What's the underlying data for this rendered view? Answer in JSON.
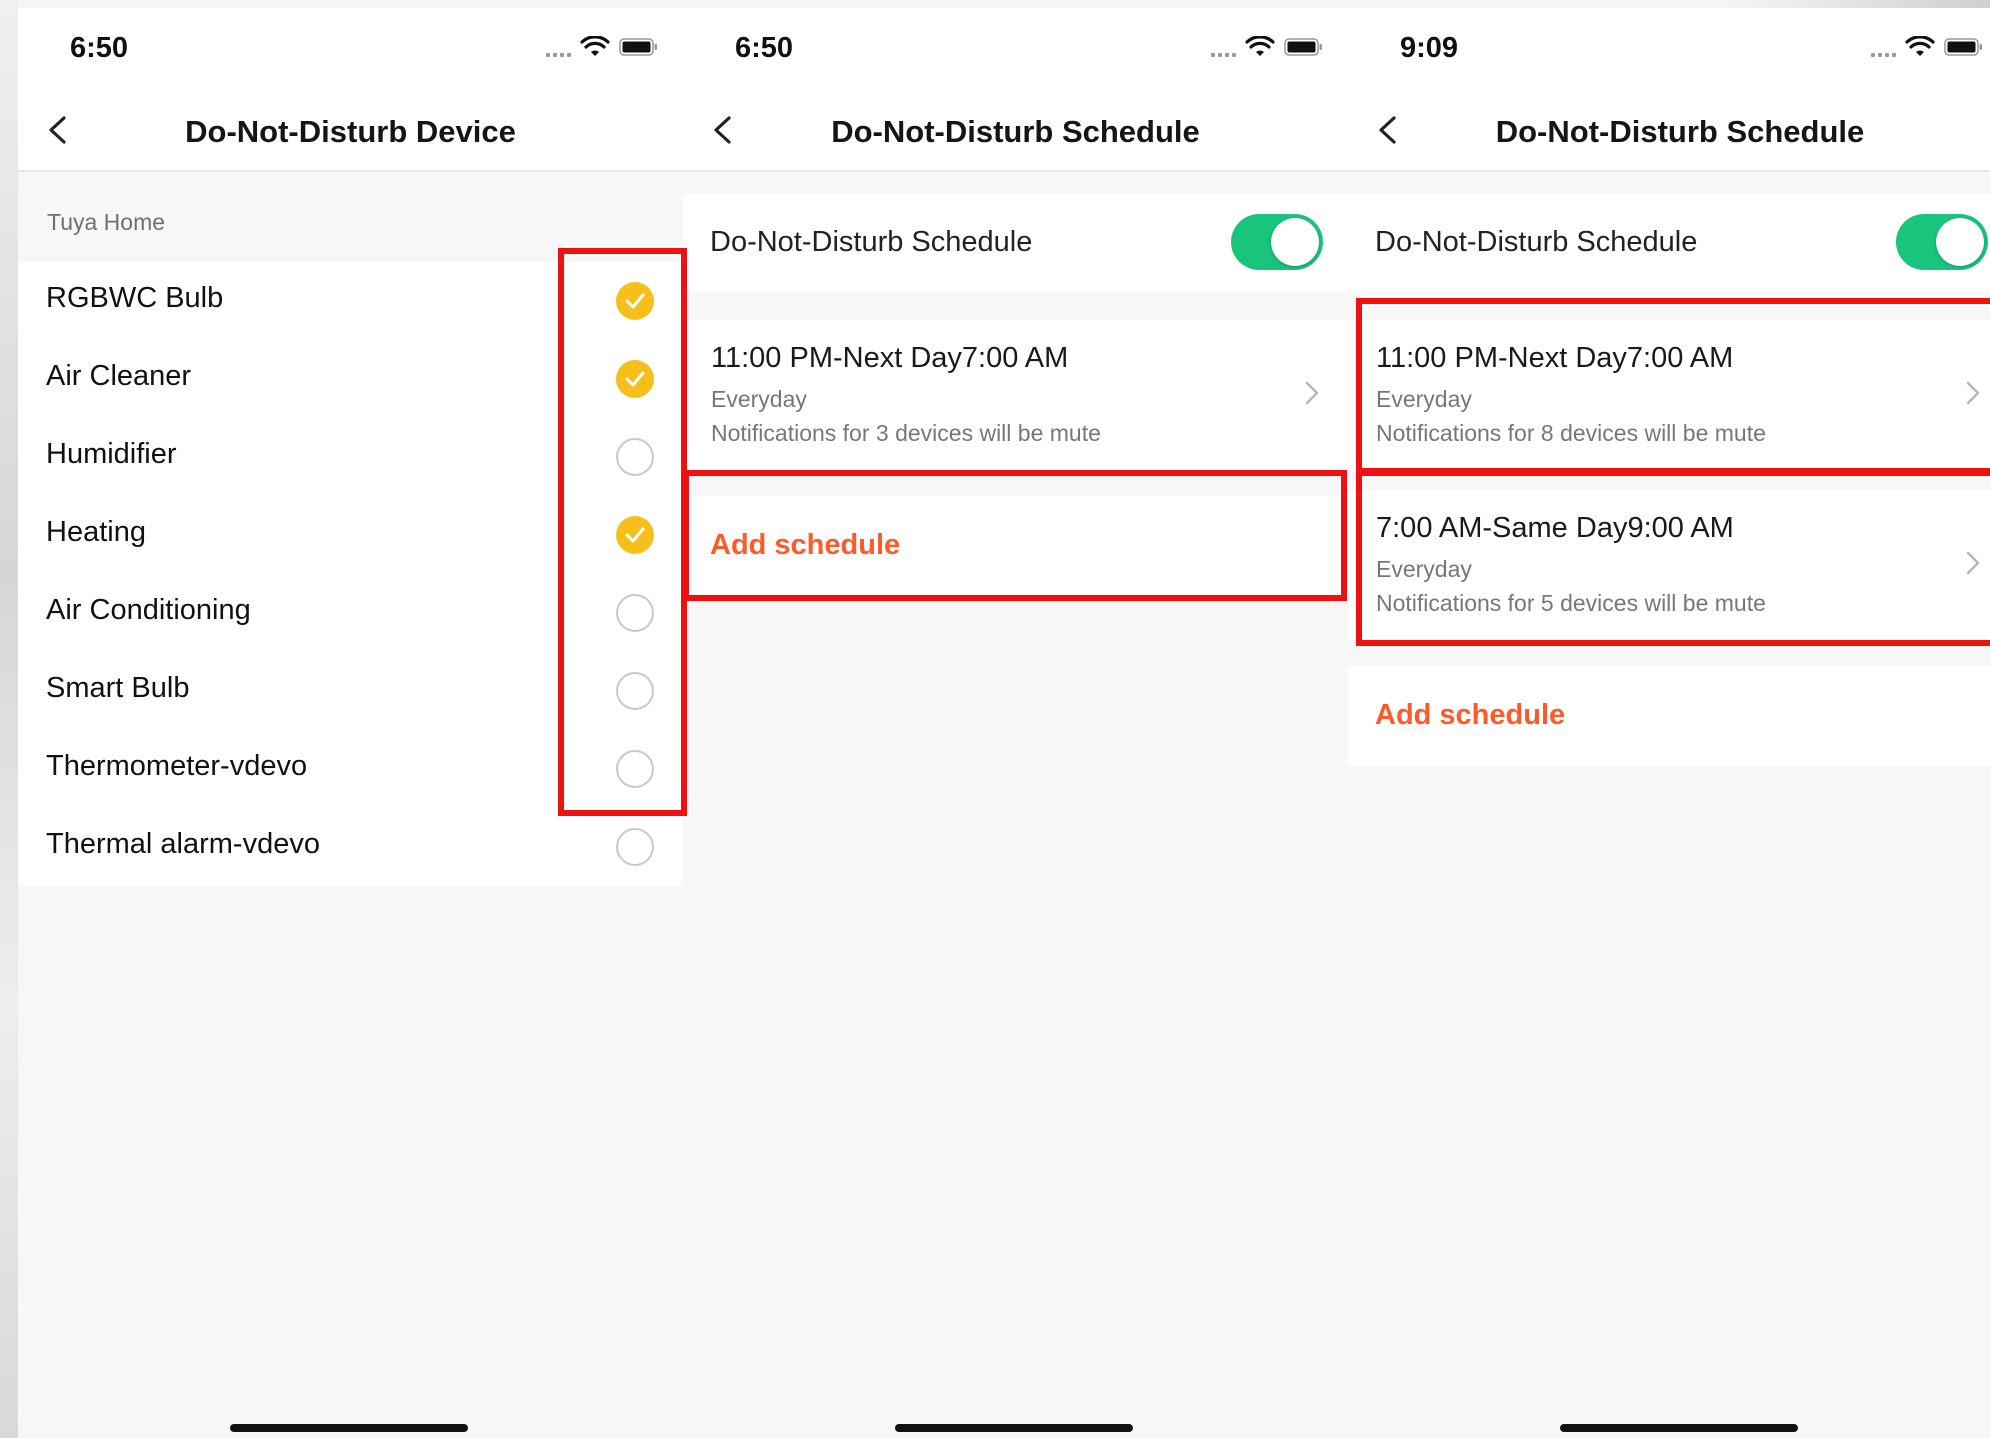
{
  "screens": [
    {
      "status_time": "6:50",
      "title": "Do-Not-Disturb Device",
      "section_label": "Tuya Home",
      "devices": [
        {
          "name": "RGBWC Bulb",
          "checked": true
        },
        {
          "name": "Air Cleaner",
          "checked": true
        },
        {
          "name": "Humidifier",
          "checked": false
        },
        {
          "name": "Heating",
          "checked": true
        },
        {
          "name": "Air Conditioning",
          "checked": false
        },
        {
          "name": "Smart Bulb",
          "checked": false
        },
        {
          "name": "Thermometer-vdevo",
          "checked": false
        },
        {
          "name": "Thermal alarm-vdevo",
          "checked": false
        }
      ]
    },
    {
      "status_time": "6:50",
      "title": "Do-Not-Disturb Schedule",
      "toggle_label": "Do-Not-Disturb Schedule",
      "toggle_on": true,
      "schedules": [
        {
          "time": "11:00 PM-Next Day7:00 AM",
          "repeat": "Everyday",
          "note": "Notifications for 3 devices will be mute"
        }
      ],
      "add_label": "Add schedule"
    },
    {
      "status_time": "9:09",
      "title": "Do-Not-Disturb Schedule",
      "toggle_label": "Do-Not-Disturb Schedule",
      "toggle_on": true,
      "schedules": [
        {
          "time": "11:00 PM-Next Day7:00 AM",
          "repeat": "Everyday",
          "note": "Notifications for 8 devices will be mute"
        },
        {
          "time": "7:00 AM-Same Day9:00 AM",
          "repeat": "Everyday",
          "note": "Notifications for 5 devices will be mute"
        }
      ],
      "add_label": "Add schedule"
    }
  ],
  "colors": {
    "accent_check": "#f6bf1a",
    "toggle_on": "#19c47d",
    "add_schedule": "#ff5a28",
    "highlight_box": "#ee1111"
  }
}
